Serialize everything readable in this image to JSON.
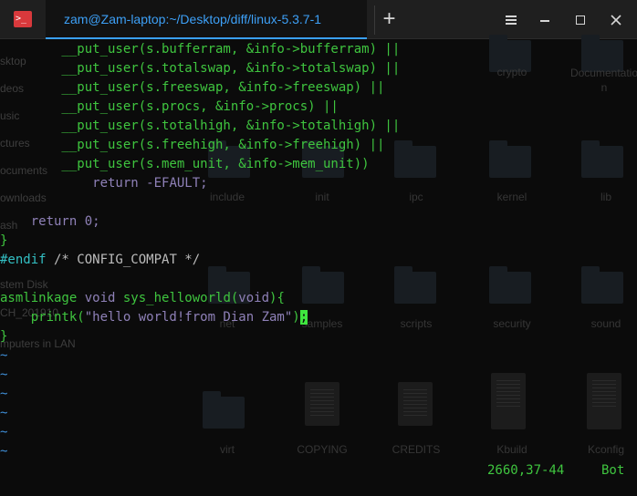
{
  "titlebar": {
    "app_icon_glyph": ">_",
    "tab_title": "zam@Zam-laptop:~/Desktop/diff/linux-5.3.7-1",
    "new_tab_glyph": "+"
  },
  "background": {
    "sidebar": [
      "sktop",
      "deos",
      "usic",
      "ctures",
      "ocuments",
      "ownloads",
      "ash",
      "stem Disk",
      "CH_201910",
      "mputers in LAN"
    ],
    "files": {
      "crypto": "crypto",
      "documentation": "Documentatio\nn",
      "include": "include",
      "init": "init",
      "ipc": "ipc",
      "kernel": "kernel",
      "lib": "lib",
      "net": "net",
      "samples": "samples",
      "scripts": "scripts",
      "security": "security",
      "sound": "sound",
      "virt": "virt",
      "copying": "COPYING",
      "credits": "CREDITS",
      "kbuild": "Kbuild",
      "kconfig": "Kconfig"
    }
  },
  "code": {
    "l1": "        __put_user(s.bufferram, &info->bufferram) ||",
    "l2": "        __put_user(s.totalswap, &info->totalswap) ||",
    "l3": "        __put_user(s.freeswap, &info->freeswap) ||",
    "l4": "        __put_user(s.procs, &info->procs) ||",
    "l5": "        __put_user(s.totalhigh, &info->totalhigh) ||",
    "l6": "        __put_user(s.freehigh, &info->freehigh) ||",
    "l7": "        __put_user(s.mem_unit, &info->mem_unit))",
    "l8_kw": "            return ",
    "l8_val": "-EFAULT",
    "l8_end": ";",
    "l9_kw": "    return ",
    "l9_val": "0",
    "l9_end": ";",
    "l10": "}",
    "l11_pp": "#endif",
    "l11_cm": " /* CONFIG_COMPAT */",
    "l12_a": "asmlinkage ",
    "l12_b": "void",
    "l12_c": " sys_helloworld(",
    "l12_d": "void",
    "l12_e": "){",
    "l13_a": "    printk(",
    "l13_str": "\"hello world!from Dian Zam\"",
    "l13_b": ")",
    "l13_cursor": ";",
    "l14": "}",
    "tilde": "~"
  },
  "status": {
    "position": "2660,37-44",
    "scroll": "Bot"
  },
  "colors": {
    "accent": "#3aa0ff",
    "code_green": "#3fc53f",
    "string_purple": "#8f81b8",
    "preproc_cyan": "#33c0c4",
    "tilde_blue": "#3f8fd8",
    "cursor": "#3fe63f"
  }
}
